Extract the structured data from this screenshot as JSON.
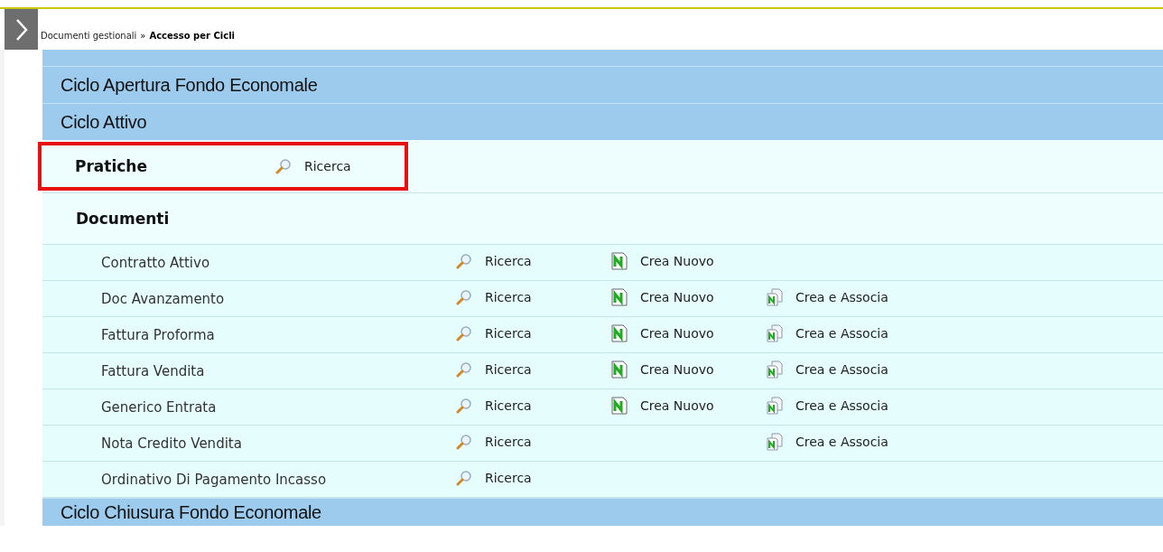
{
  "breadcrumb": {
    "parent": "Documenti gestionali",
    "separator": "»",
    "current": "Accesso per Cicli"
  },
  "cycles_top": [
    {
      "title": "Ciclo Apertura Fondo Economale"
    },
    {
      "title": "Ciclo Attivo"
    }
  ],
  "pratiche": {
    "title": "Pratiche",
    "search": "Ricerca",
    "highlighted": true
  },
  "documenti": {
    "title": "Documenti",
    "rows": [
      {
        "name": "Contratto Attivo",
        "search": "Ricerca",
        "create_new": "Crea Nuovo"
      },
      {
        "name": "Doc Avanzamento",
        "search": "Ricerca",
        "create_new": "Crea Nuovo",
        "create_link": "Crea e Associa"
      },
      {
        "name": "Fattura Proforma",
        "search": "Ricerca",
        "create_new": "Crea Nuovo",
        "create_link": "Crea e Associa"
      },
      {
        "name": "Fattura Vendita",
        "search": "Ricerca",
        "create_new": "Crea Nuovo",
        "create_link": "Crea e Associa"
      },
      {
        "name": "Generico Entrata",
        "search": "Ricerca",
        "create_new": "Crea Nuovo",
        "create_link": "Crea e Associa"
      },
      {
        "name": "Nota Credito Vendita",
        "search": "Ricerca",
        "create_link": "Crea e Associa"
      },
      {
        "name": "Ordinativo Di Pagamento Incasso",
        "search": "Ricerca"
      }
    ]
  },
  "cycles_bottom": [
    {
      "title": "Ciclo Chiusura Fondo Economale"
    }
  ]
}
